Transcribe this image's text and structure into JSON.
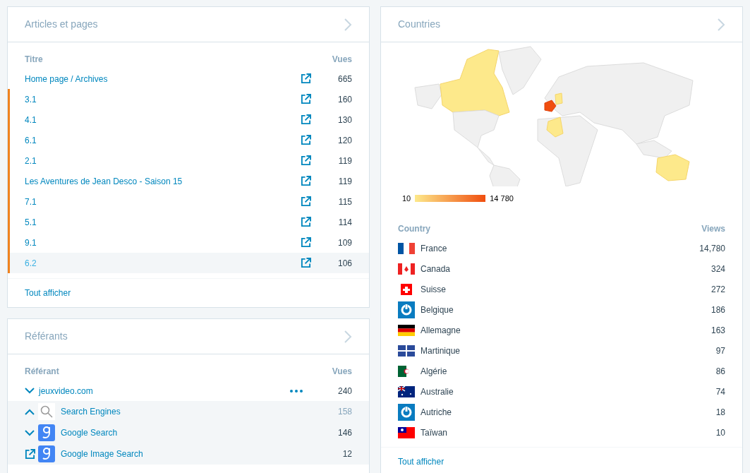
{
  "articles": {
    "title": "Articles et pages",
    "columns": [
      "Titre",
      "Vues"
    ],
    "rows": [
      {
        "title": "Home page / Archives",
        "views": "665",
        "marked": false,
        "hovered": false
      },
      {
        "title": "3.1",
        "views": "160",
        "marked": true,
        "hovered": false
      },
      {
        "title": "4.1",
        "views": "130",
        "marked": true,
        "hovered": false
      },
      {
        "title": "6.1",
        "views": "120",
        "marked": true,
        "hovered": false
      },
      {
        "title": "2.1",
        "views": "119",
        "marked": true,
        "hovered": false
      },
      {
        "title": "Les Aventures de Jean Desco - Saison 15",
        "views": "119",
        "marked": true,
        "hovered": false
      },
      {
        "title": "7.1",
        "views": "115",
        "marked": true,
        "hovered": false
      },
      {
        "title": "5.1",
        "views": "114",
        "marked": true,
        "hovered": false
      },
      {
        "title": "9.1",
        "views": "109",
        "marked": true,
        "hovered": false
      },
      {
        "title": "6.2",
        "views": "106",
        "marked": true,
        "hovered": true
      }
    ],
    "footer": "Tout afficher"
  },
  "referrers": {
    "title": "Référants",
    "columns": [
      "Référant",
      "Vues"
    ],
    "rows": [
      {
        "kind": "collapsed",
        "name": "jeuxvideo.com",
        "views": "240",
        "more": true,
        "grouped": false,
        "muted": false
      },
      {
        "kind": "expanded",
        "name": "Search Engines",
        "views": "158",
        "more": false,
        "grouped": true,
        "muted": true
      },
      {
        "kind": "collapsed",
        "name": "Google Search",
        "views": "146",
        "more": false,
        "grouped": true,
        "muted": false
      },
      {
        "kind": "link",
        "name": "Google Image Search",
        "views": "12",
        "more": false,
        "grouped": true,
        "muted": false
      }
    ]
  },
  "countries": {
    "title": "Countries",
    "legend": {
      "min": "10",
      "max": "14 780"
    },
    "columns": [
      "Country",
      "Views"
    ],
    "rows": [
      {
        "name": "France",
        "views": "14,780"
      },
      {
        "name": "Canada",
        "views": "324"
      },
      {
        "name": "Suisse",
        "views": "272"
      },
      {
        "name": "Belgique",
        "views": "186"
      },
      {
        "name": "Allemagne",
        "views": "163"
      },
      {
        "name": "Martinique",
        "views": "97"
      },
      {
        "name": "Algérie",
        "views": "86"
      },
      {
        "name": "Australie",
        "views": "74"
      },
      {
        "name": "Autriche",
        "views": "18"
      },
      {
        "name": "Taïwan",
        "views": "10"
      }
    ],
    "footer": "Tout afficher"
  }
}
